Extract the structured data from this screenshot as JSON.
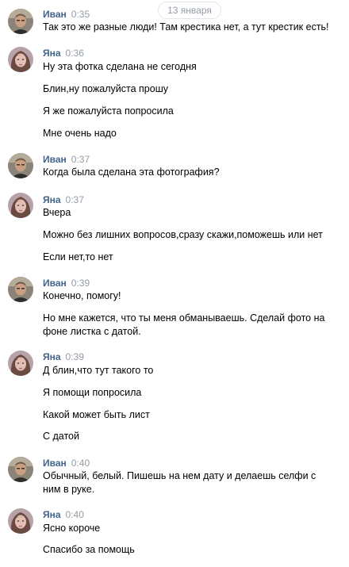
{
  "date_separator": "13 января",
  "messages": [
    {
      "author": "Иван",
      "time": "0:35",
      "avatar": "ivan",
      "lines": [
        "Так это же разные люди! Там крестика нет, а тут крестик есть!"
      ]
    },
    {
      "author": "Яна",
      "time": "0:36",
      "avatar": "yana",
      "lines": [
        "Ну эта фотка сделана не сегодня",
        "Блин,ну пожалуйста прошу",
        "Я же пожалуйста попросила",
        "Мне очень надо"
      ]
    },
    {
      "author": "Иван",
      "time": "0:37",
      "avatar": "ivan",
      "lines": [
        "Когда была сделана эта фотография?"
      ]
    },
    {
      "author": "Яна",
      "time": "0:37",
      "avatar": "yana",
      "lines": [
        "Вчера",
        "Можно без лишних вопросов,сразу скажи,поможешь или нет",
        "Если нет,то нет"
      ]
    },
    {
      "author": "Иван",
      "time": "0:39",
      "avatar": "ivan",
      "lines": [
        "Конечно, помогу!",
        "Но мне кажется, что ты меня обманываешь. Сделай фото на фоне листка с датой."
      ]
    },
    {
      "author": "Яна",
      "time": "0:39",
      "avatar": "yana",
      "lines": [
        "Д блин,что тут такого то",
        "Я помощи попросила",
        "Какой может быть лист",
        "С датой"
      ]
    },
    {
      "author": "Иван",
      "time": "0:40",
      "avatar": "ivan",
      "lines": [
        "Обычный, белый. Пишешь на нем дату и делаешь селфи с ним в руке."
      ]
    },
    {
      "author": "Яна",
      "time": "0:40",
      "avatar": "yana",
      "lines": [
        "Ясно короче",
        "Спасибо за помощь"
      ]
    }
  ]
}
